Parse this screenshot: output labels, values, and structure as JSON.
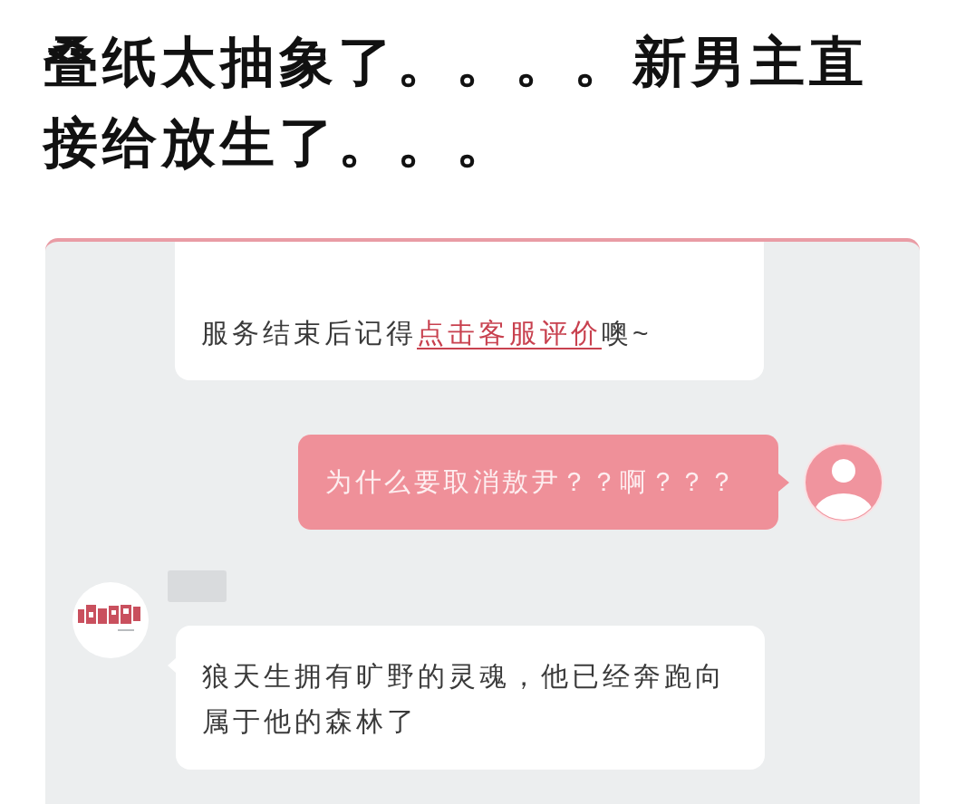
{
  "post": {
    "title": "叠纸太抽象了。。。。新男主直接给放生了。。。"
  },
  "chat": {
    "messages": [
      {
        "kind": "agent",
        "show_avatar": false,
        "segments": [
          {
            "kind": "plain",
            "text": "服务结束后记得"
          },
          {
            "kind": "link",
            "text": "点击客服评价"
          },
          {
            "kind": "plain",
            "text": "噢~"
          }
        ]
      },
      {
        "kind": "user",
        "segments": [
          {
            "kind": "plain",
            "text": "为什么要取消敖尹？？啊？？？"
          }
        ]
      },
      {
        "kind": "agent",
        "show_avatar": true,
        "segments": [
          {
            "kind": "plain",
            "text": "狼天生拥有旷野的灵魂，他已经奔跑向属于他的森林了"
          }
        ]
      }
    ]
  }
}
